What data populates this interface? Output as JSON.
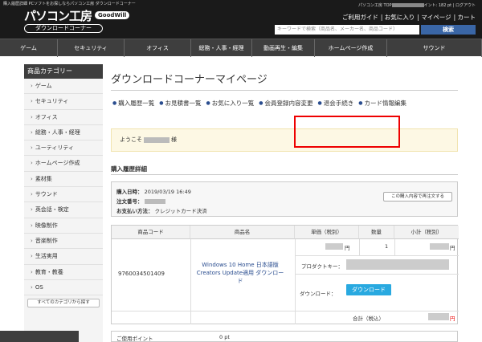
{
  "header": {
    "tagline": "購入履歴詳細 PCソフトをお探しならパソコン工房 ダウンロードコーナー",
    "logo_text": "パソコン工房",
    "logo_badge": "GoodWill",
    "logo_sub": "ダウンロードコーナー",
    "user_prefix": "パソコン工房 TOP",
    "user_points": "イント: 182 pt",
    "logout": "| ログアウト",
    "links": [
      "ご利用ガイド",
      "| お気に入り",
      "| マイページ",
      "| カート"
    ],
    "search_placeholder": "キーワードで検索（商品名、メーカー名、商品コード）",
    "search_button": "検索"
  },
  "nav": [
    {
      "label": "ゲーム",
      "w": 72
    },
    {
      "label": "セキュリティ",
      "w": 83
    },
    {
      "label": "オフィス",
      "w": 83
    },
    {
      "label": "総務・人事・経理",
      "w": 76
    },
    {
      "label": "動画再生・編集",
      "w": 78
    },
    {
      "label": "ホームページ作成",
      "w": 90
    },
    {
      "label": "サウンド",
      "w": 118
    }
  ],
  "sidebar": {
    "heading": "商品カテゴリー",
    "items": [
      "ゲーム",
      "セキュリティ",
      "オフィス",
      "総務・人事・経理",
      "ユーティリティ",
      "ホームページ作成",
      "素材集",
      "サウンド",
      "英会話・検定",
      "映像制作",
      "音楽制作",
      "生活実用",
      "教育・教養",
      "OS"
    ],
    "all_button": "すべてのカテゴリから探す"
  },
  "main": {
    "title": "ダウンロードコーナーマイページ",
    "links": [
      "購入履歴一覧",
      "お見積書一覧",
      "お気に入り一覧",
      "会員登録内容変更",
      "退会手続き",
      "カード情報編集"
    ],
    "welcome_prefix": "ようこそ",
    "welcome_suffix": "様",
    "section_title": "購入履歴詳細",
    "order": {
      "date_label": "購入日時：",
      "date_value": "2019/03/19 16:49",
      "no_label": "注文番号：",
      "pay_label": "お支払い方法：",
      "pay_value": "クレジットカード決済",
      "reorder_button": "この購入内容で再注文する"
    },
    "table": {
      "headers": [
        "商品コード",
        "商品名",
        "単価（税別）",
        "数量",
        "小計（税別）"
      ],
      "code": "9760034501409",
      "product_name": "Windows 10 Home 日本語版 Creators Update適用 ダウンロード",
      "price_suffix": "円",
      "qty": "1",
      "subtotal_suffix": "円",
      "product_key_label": "プロダクトキー：",
      "download_label": "ダウンロード：",
      "download_button": "ダウンロード",
      "total_label": "合計（税込）",
      "total_suffix": "円"
    },
    "points_label": "ご使用ポイント",
    "points_value": "0 pt"
  }
}
